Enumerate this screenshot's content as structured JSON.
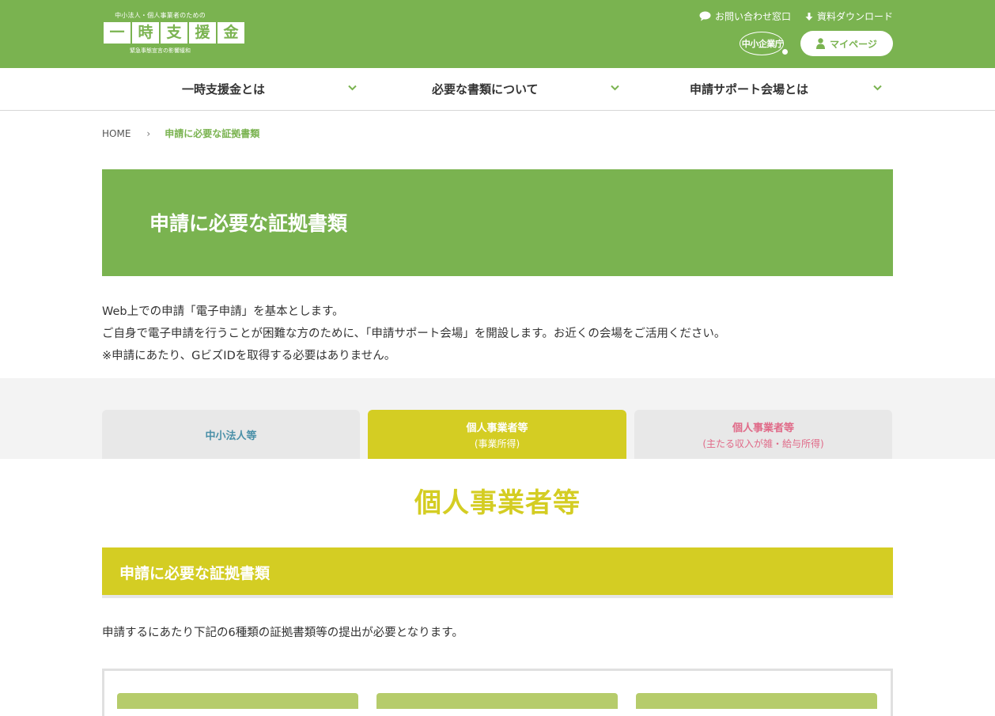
{
  "header": {
    "logo_tagline": "中小法人・個人事業者のための",
    "logo_chars": [
      "一",
      "時",
      "支",
      "援",
      "金"
    ],
    "logo_sub": "緊急事態宣言の影響緩和",
    "contact_label": "お問い合わせ窓口",
    "download_label": "資料ダウンロード",
    "agency_label": "中小企業庁",
    "mypage_label": "マイページ"
  },
  "nav": {
    "items": [
      {
        "label": "一時支援金とは"
      },
      {
        "label": "必要な書類について"
      },
      {
        "label": "申請サポート会場とは"
      }
    ]
  },
  "breadcrumb": {
    "home": "HOME",
    "separator": "›",
    "current": "申請に必要な証拠書類"
  },
  "page": {
    "title": "申請に必要な証拠書類",
    "intro": [
      "Web上での申請「電子申請」を基本とします。",
      "ご自身で電子申請を行うことが困難な方のために、「申請サポート会場」を開設します。お近くの会場をご活用ください。",
      "※申請にあたり、GビズIDを取得する必要はありません。"
    ]
  },
  "tabs": [
    {
      "label": "中小法人等",
      "sub": ""
    },
    {
      "label": "個人事業者等",
      "sub": "(事業所得)"
    },
    {
      "label": "個人事業者等",
      "sub": "(主たる収入が雑・給与所得)"
    }
  ],
  "section": {
    "title": "個人事業者等",
    "bar_title": "申請に必要な証拠書類",
    "description": "申請するにあたり下記の6種類の証拠書類等の提出が必要となります。"
  },
  "colors": {
    "brand_green": "#7ab350",
    "active_yellow": "#d4cd23",
    "tab_blue_text": "#4a90a8",
    "tab_pink_text": "#e06a88",
    "card_header_green": "#b6cc6b"
  }
}
